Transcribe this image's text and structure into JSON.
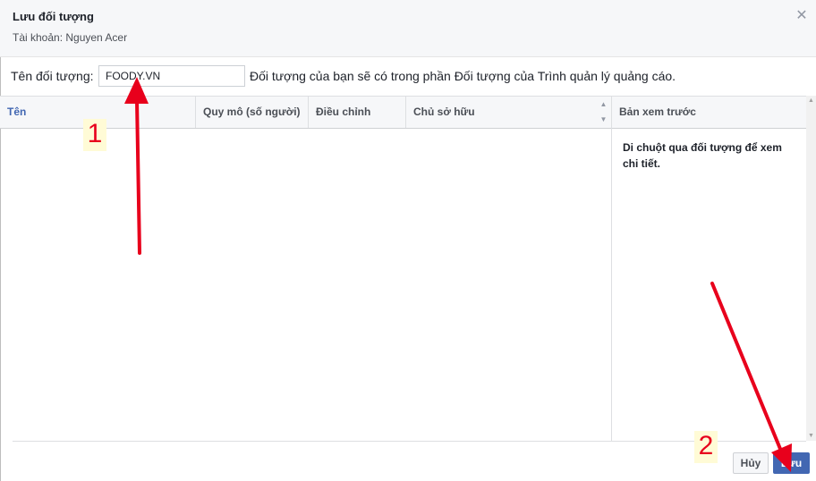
{
  "dialog": {
    "title": "Lưu đối tượng",
    "account": "Tài khoản: Nguyen Acer",
    "close_icon": "close-icon"
  },
  "audience_name": {
    "label": "Tên đối tượng:",
    "value": "FOODY.VN",
    "hint": "Đối tượng của bạn sẽ có trong phần Đối tượng của Trình quản lý quảng cáo."
  },
  "table": {
    "columns": [
      "Tên",
      "Quy mô (số người)",
      "Điều chỉnh",
      "Chủ sở hữu"
    ]
  },
  "preview": {
    "header": "Bản xem trước",
    "text": "Di chuột qua đối tượng để xem chi tiết."
  },
  "buttons": {
    "cancel": "Hủy",
    "save": "Lưu"
  },
  "annotations": {
    "step1": "1",
    "step2": "2",
    "arrow_color": "#e8001c"
  },
  "colors": {
    "accent": "#4267b2",
    "header_bg": "#f6f7f9"
  }
}
